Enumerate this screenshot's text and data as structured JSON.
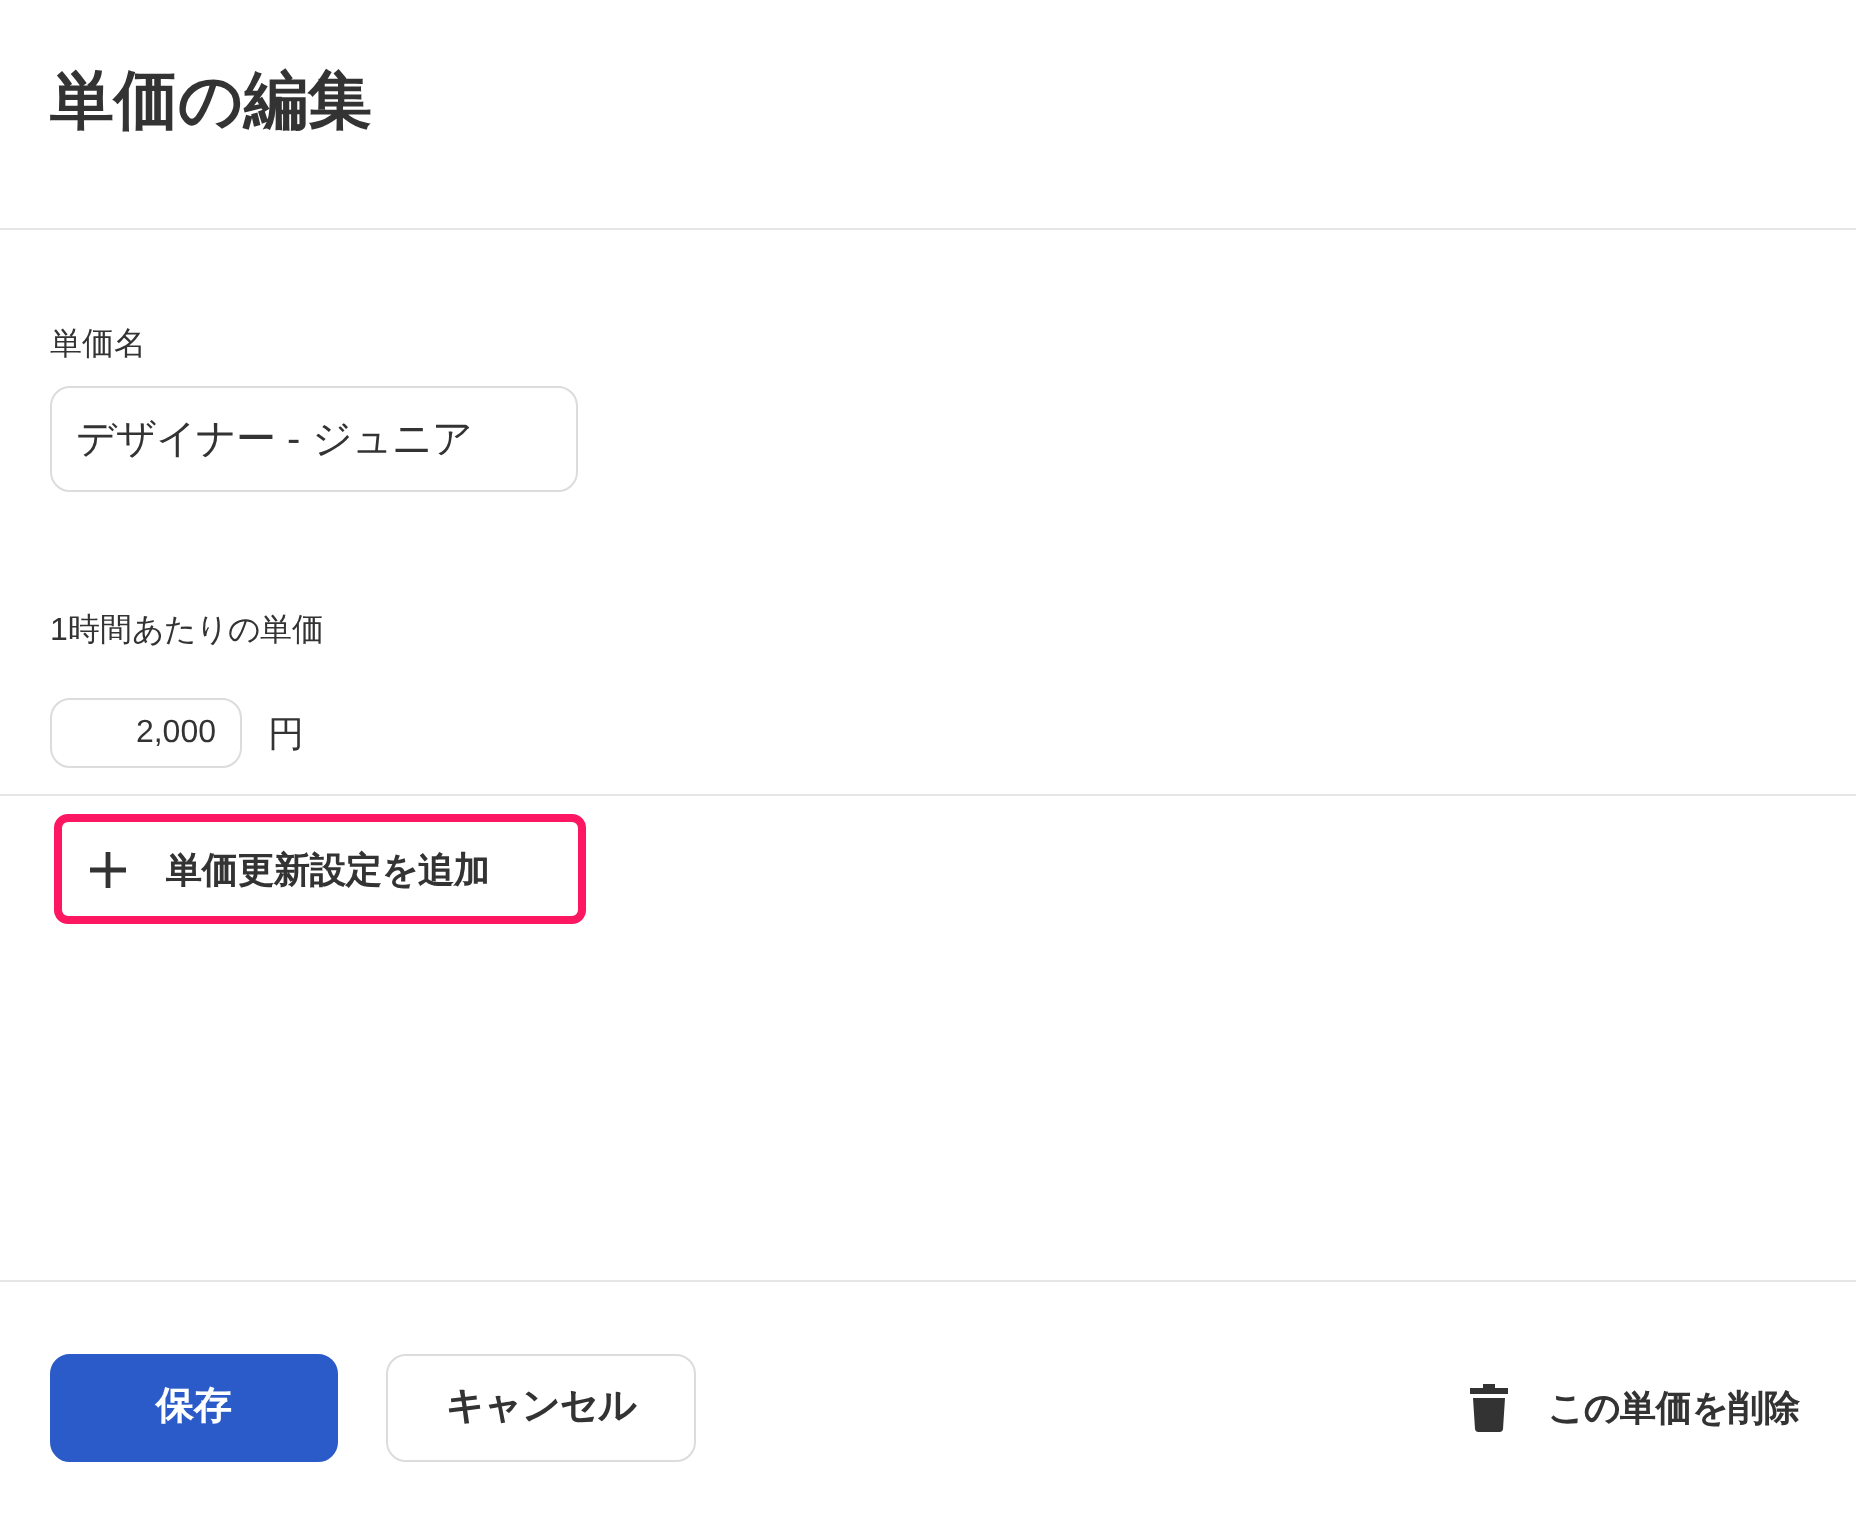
{
  "page": {
    "title": "単価の編集"
  },
  "form": {
    "name_field": {
      "label": "単価名",
      "value": "デザイナー - ジュニア"
    },
    "rate_field": {
      "label": "1時間あたりの単価",
      "value": "2,000",
      "unit": "円"
    }
  },
  "add_update_button": {
    "label": "単価更新設定を追加",
    "highlighted": true
  },
  "footer": {
    "buttons": [
      {
        "kind": "primary",
        "label": "保存"
      },
      {
        "kind": "secondary",
        "label": "キャンセル"
      }
    ],
    "delete_button": {
      "label": "この単価を削除"
    }
  }
}
